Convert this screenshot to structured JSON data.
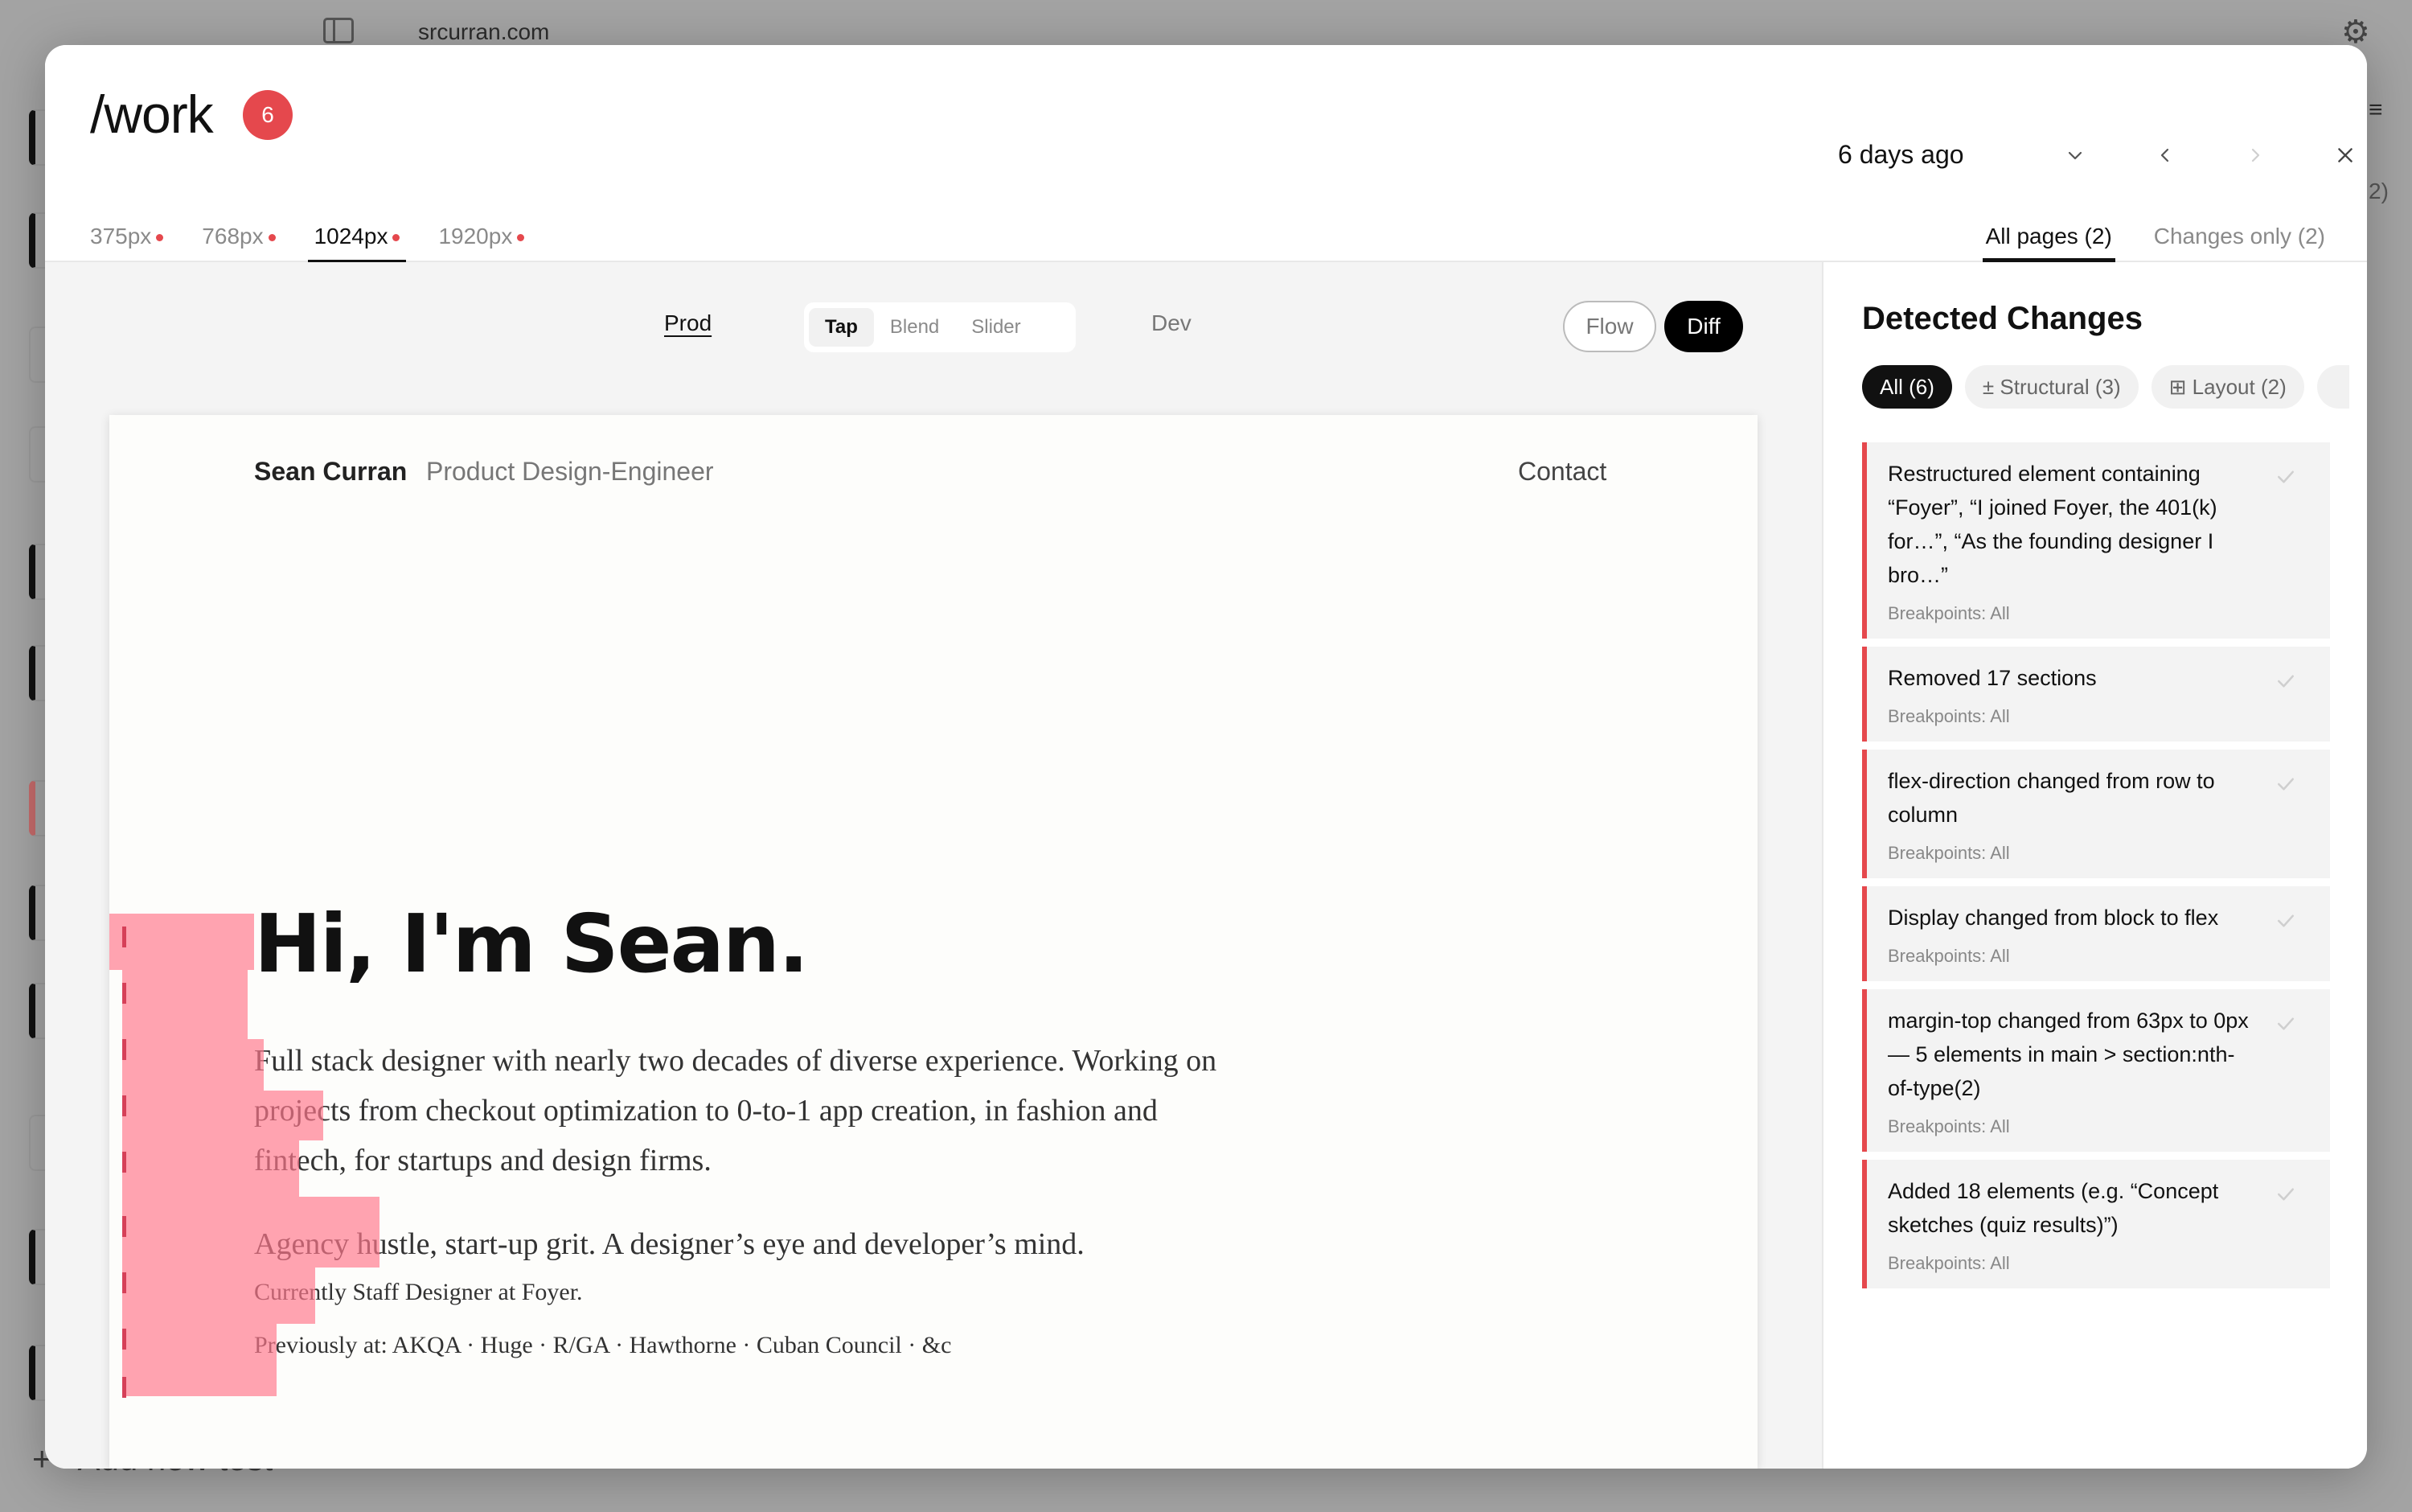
{
  "background": {
    "domain": "srcurran.com",
    "add_test_label": "Add new test",
    "right_edge_1": "≡",
    "right_edge_2": "2)"
  },
  "header": {
    "title": "/work",
    "count": "6",
    "date": "6 days ago",
    "breakpoints": [
      {
        "label": "375px"
      },
      {
        "label": "768px"
      },
      {
        "label": "1024px"
      },
      {
        "label": "1920px"
      }
    ],
    "views": [
      {
        "label": "All pages (2)"
      },
      {
        "label": "Changes only (2)"
      }
    ]
  },
  "toolbar": {
    "prod": "Prod",
    "dev": "Dev",
    "modes": [
      "Tap",
      "Blend",
      "Slider"
    ],
    "flow": "Flow",
    "diff": "Diff"
  },
  "preview": {
    "name": "Sean Curran",
    "role": "Product Design-Engineer",
    "contact": "Contact",
    "hero": "Hi, I'm Sean.",
    "para1": "Full stack designer with nearly two decades of diverse experience. Working on projects from checkout optimization to 0-to-1 app creation, in fashion and fintech, for startups and design firms.",
    "para2": "Agency hustle, start-up grit. A designer’s eye and developer’s mind.",
    "para3": "Currently Staff Designer at Foyer.",
    "para4": "Previously at: AKQA · Huge · R/GA · Hawthorne · Cuban Council · &c"
  },
  "panel": {
    "title": "Detected Changes",
    "filters": [
      "All (6)",
      "± Structural (3)",
      "⊞ Layout (2)"
    ],
    "changes": [
      {
        "text": "Restructured element containing “Foyer”, “I joined Foyer, the 401(k) for…”, “As the founding designer I bro…”",
        "meta": "Breakpoints: All"
      },
      {
        "text": "Removed 17 sections",
        "meta": "Breakpoints: All"
      },
      {
        "text": "flex-direction changed from row to column",
        "meta": "Breakpoints: All"
      },
      {
        "text": "Display changed from block to flex",
        "meta": "Breakpoints: All"
      },
      {
        "text": "margin-top changed from 63px to 0px — 5 elements in main > section:nth-of-type(2)",
        "meta": "Breakpoints: All"
      },
      {
        "text": "Added 18 elements (e.g. “Concept sketches (quiz results)”)",
        "meta": "Breakpoints: All"
      }
    ]
  },
  "colors": {
    "accent_red": "#e5484d",
    "diff_overlay": "#ff788c"
  }
}
